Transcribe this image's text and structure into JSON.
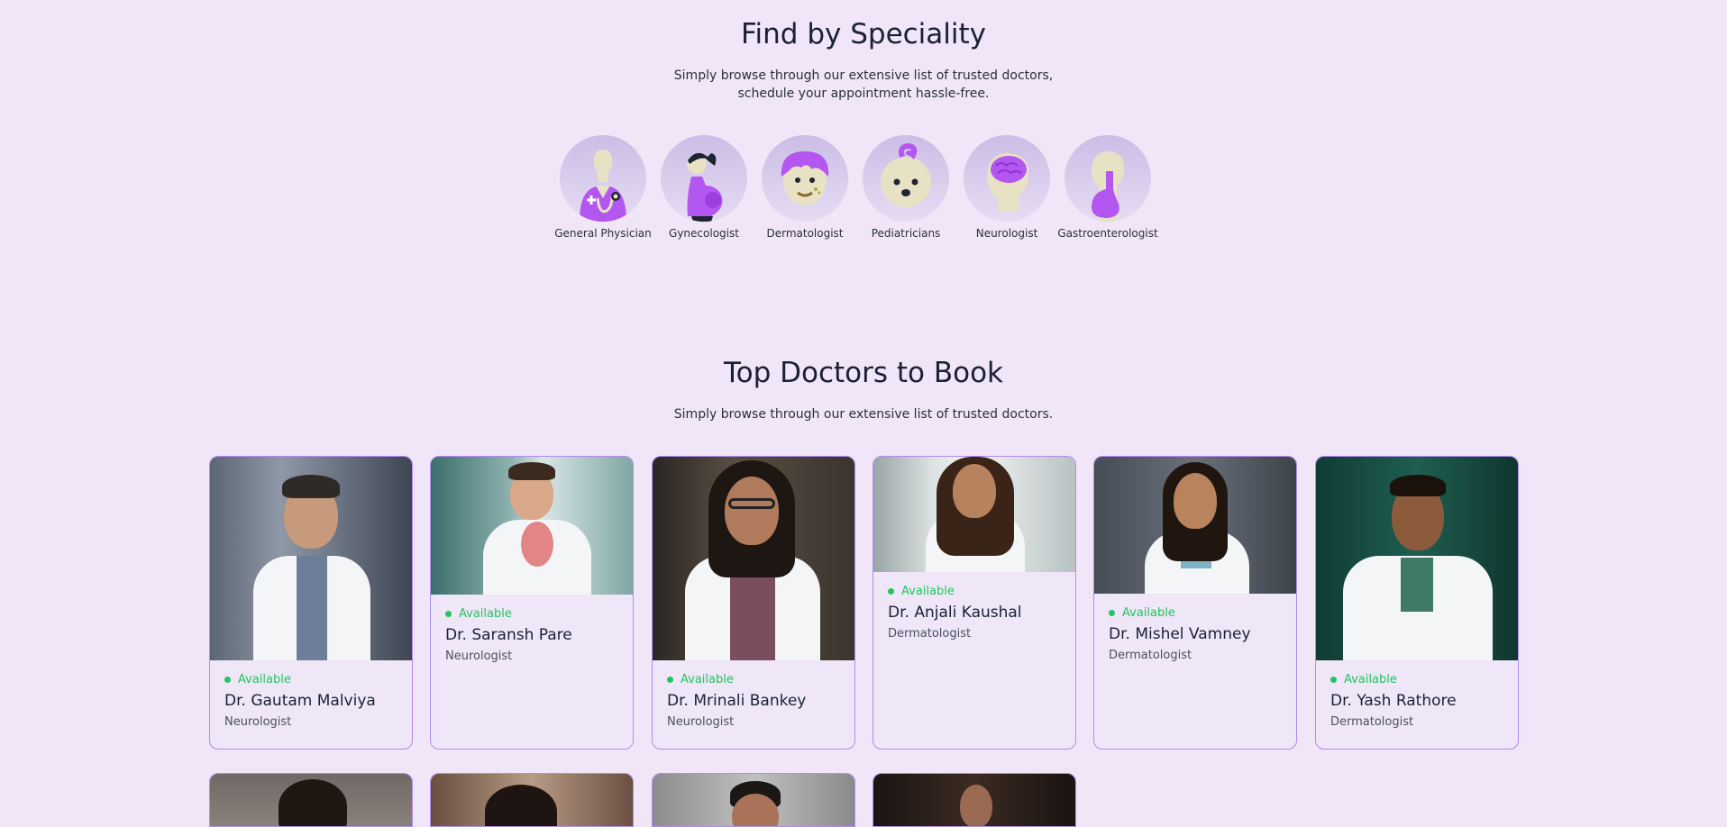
{
  "speciality": {
    "title": "Find by Speciality",
    "subtitle": "Simply browse through our extensive list of trusted doctors, schedule your appointment hassle-free.",
    "items": [
      {
        "label": "General Physician",
        "icon": "general-physician-icon"
      },
      {
        "label": "Gynecologist",
        "icon": "gynecologist-icon"
      },
      {
        "label": "Dermatologist",
        "icon": "dermatologist-icon"
      },
      {
        "label": "Pediatricians",
        "icon": "pediatrician-icon"
      },
      {
        "label": "Neurologist",
        "icon": "neurologist-icon"
      },
      {
        "label": "Gastroenterologist",
        "icon": "gastroenterologist-icon"
      }
    ]
  },
  "doctors": {
    "title": "Top Doctors to Book",
    "subtitle": "Simply browse through our extensive list of trusted doctors.",
    "list": [
      {
        "name": "Dr. Gautam Malviya",
        "speciality": "Neurologist",
        "status": "Available"
      },
      {
        "name": "Dr. Saransh Pare",
        "speciality": "Neurologist",
        "status": "Available"
      },
      {
        "name": "Dr. Mrinali Bankey",
        "speciality": "Neurologist",
        "status": "Available"
      },
      {
        "name": "Dr. Anjali Kaushal",
        "speciality": "Dermatologist",
        "status": "Available"
      },
      {
        "name": "Dr. Mishel Vamney",
        "speciality": "Dermatologist",
        "status": "Available"
      },
      {
        "name": "Dr. Yash Rathore",
        "speciality": "Dermatologist",
        "status": "Available"
      }
    ]
  },
  "colors": {
    "background": "#f0e6f8",
    "card_border": "#b48af0",
    "available": "#22c55e",
    "icon_accent": "#b456f0"
  }
}
